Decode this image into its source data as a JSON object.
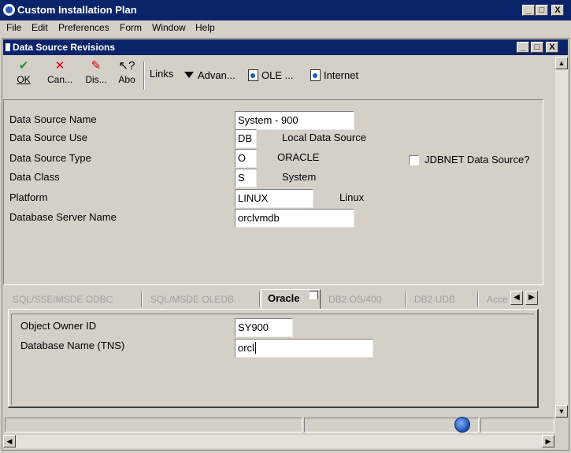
{
  "app": {
    "title": "Custom Installation Plan",
    "window_buttons": [
      "_",
      "□",
      "X"
    ]
  },
  "menu": [
    {
      "label": "File"
    },
    {
      "label": "Edit"
    },
    {
      "label": "Preferences"
    },
    {
      "label": "Form"
    },
    {
      "label": "Window"
    },
    {
      "label": "Help"
    }
  ],
  "form": {
    "title": "Data Source Revisions",
    "window_buttons": [
      "_",
      "□",
      "X"
    ]
  },
  "toolbar": {
    "buttons": [
      {
        "label": "OK",
        "icon": "check-icon"
      },
      {
        "label": "Can...",
        "icon": "x-icon"
      },
      {
        "label": "Dis...",
        "icon": "display-icon"
      },
      {
        "label": "Abo",
        "icon": "about-icon"
      }
    ],
    "links_label": "Links",
    "advanced_label": "Advan...",
    "ole_label": "OLE ...",
    "internet_label": "Internet"
  },
  "fields": {
    "data_source_name": {
      "label": "Data Source Name",
      "value": "System - 900"
    },
    "data_source_use": {
      "label": "Data Source Use",
      "value": "DB",
      "description": "Local Data Source"
    },
    "data_source_type": {
      "label": "Data Source Type",
      "value": "O",
      "description": "ORACLE"
    },
    "data_class": {
      "label": "Data Class",
      "value": "S",
      "description": "System"
    },
    "platform": {
      "label": "Platform",
      "value": "LINUX",
      "description": "Linux"
    },
    "database_server_name": {
      "label": "Database Server Name",
      "value": "orclvmdb"
    },
    "jdbnet": {
      "label": "JDBNET Data Source?",
      "checked": false
    }
  },
  "tabs": [
    {
      "label": "SQL/SSE/MSDE ODBC",
      "active": false
    },
    {
      "label": "SQL/MSDE OLEDB",
      "active": false
    },
    {
      "label": "Oracle",
      "active": true
    },
    {
      "label": "DB2 OS/400",
      "active": false
    },
    {
      "label": "DB2 UDB",
      "active": false
    },
    {
      "label": "Acce",
      "active": false
    }
  ],
  "oracle_tab": {
    "object_owner_id": {
      "label": "Object Owner ID",
      "value": "SY900"
    },
    "database_name_tns": {
      "label": "Database Name (TNS)",
      "value": "orcl"
    }
  },
  "colors": {
    "title_bar": "#0a246a",
    "face": "#d4d0c8",
    "disabled_text": "#a0a0a0"
  }
}
